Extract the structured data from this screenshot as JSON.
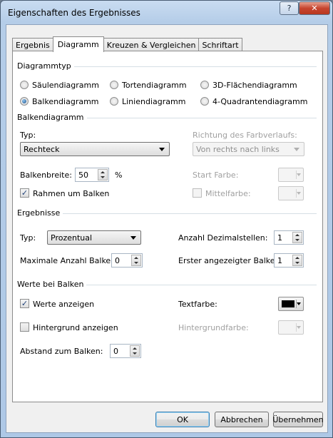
{
  "window": {
    "title": "Eigenschaften des Ergebnisses",
    "help_label": "?",
    "close_label": "✕"
  },
  "tabs": [
    {
      "label": "Ergebnis",
      "active": false
    },
    {
      "label": "Diagramm",
      "active": true
    },
    {
      "label": "Kreuzen & Vergleichen",
      "active": false
    },
    {
      "label": "Schriftart",
      "active": false
    }
  ],
  "diagrammtyp": {
    "title": "Diagrammtyp",
    "options": [
      {
        "label": "Säulendiagramm",
        "selected": false
      },
      {
        "label": "Tortendiagramm",
        "selected": false
      },
      {
        "label": "3D-Flächendiagramm",
        "selected": false
      },
      {
        "label": "Balkendiagramm",
        "selected": true
      },
      {
        "label": "Liniendiagramm",
        "selected": false
      },
      {
        "label": "4-Quadrantendiagramm",
        "selected": false
      }
    ]
  },
  "balkendiagramm": {
    "title": "Balkendiagramm",
    "typ_label": "Typ:",
    "typ_value": "Rechteck",
    "richtung_label": "Richtung des Farbverlaufs:",
    "richtung_value": "Von rechts nach links",
    "balkenbreite_label": "Balkenbreite:",
    "balkenbreite_value": "50",
    "balkenbreite_unit": "%",
    "start_farbe_label": "Start Farbe:",
    "rahmen_label": "Rahmen um Balken",
    "rahmen_checked": true,
    "mittelfarbe_label": "Mittelfarbe:",
    "mittelfarbe_checked": false
  },
  "ergebnisse": {
    "title": "Ergebnisse",
    "typ_label": "Typ:",
    "typ_value": "Prozentual",
    "dezimal_label": "Anzahl Dezimalstellen:",
    "dezimal_value": "1",
    "max_balken_label": "Maximale Anzahl Balken:",
    "max_balken_value": "0",
    "erster_balken_label": "Erster angezeigter Balken:",
    "erster_balken_value": "1"
  },
  "werte": {
    "title": "Werte bei Balken",
    "werte_anzeigen_label": "Werte anzeigen",
    "werte_anzeigen_checked": true,
    "textfarbe_label": "Textfarbe:",
    "textfarbe_color": "#000000",
    "hintergrund_label": "Hintergrund anzeigen",
    "hintergrund_checked": false,
    "hintergrundfarbe_label": "Hintergrundfarbe:",
    "abstand_label": "Abstand zum Balken:",
    "abstand_value": "0"
  },
  "buttons": {
    "ok": "OK",
    "abbrechen": "Abbrechen",
    "uebernehmen": "Übernehmen"
  }
}
